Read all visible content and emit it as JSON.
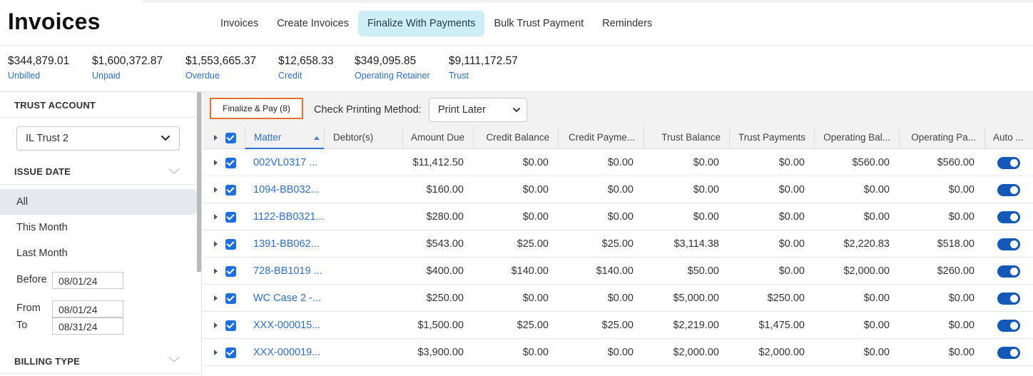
{
  "header": {
    "title": "Invoices",
    "tabs": [
      {
        "label": "Invoices"
      },
      {
        "label": "Create Invoices"
      },
      {
        "label": "Finalize With Payments"
      },
      {
        "label": "Bulk Trust Payment"
      },
      {
        "label": "Reminders"
      }
    ],
    "active_tab": "Finalize With Payments"
  },
  "summary": [
    {
      "amount": "$344,879.01",
      "label": "Unbilled"
    },
    {
      "amount": "$1,600,372.87",
      "label": "Unpaid"
    },
    {
      "amount": "$1,553,665.37",
      "label": "Overdue"
    },
    {
      "amount": "$12,658.33",
      "label": "Credit"
    },
    {
      "amount": "$349,095.85",
      "label": "Operating Retainer"
    },
    {
      "amount": "$9,111,172.57",
      "label": "Trust"
    }
  ],
  "sidebar": {
    "trust_account_heading": "TRUST ACCOUNT",
    "trust_account_value": "IL Trust 2",
    "issue_date_heading": "ISSUE DATE",
    "date_options": [
      {
        "label": "All"
      },
      {
        "label": "This Month"
      },
      {
        "label": "Last Month"
      }
    ],
    "before_label": "Before",
    "before_value": "08/01/24",
    "from_label": "From",
    "from_value": "08/01/24",
    "to_label": "To",
    "to_value": "08/31/24",
    "billing_type_heading": "BILLING TYPE"
  },
  "toolbar": {
    "finalize_label": "Finalize & Pay (8)",
    "check_printing_label": "Check Printing Method:",
    "check_printing_value": "Print Later"
  },
  "table": {
    "columns": [
      "Matter",
      "Debtor(s)",
      "Amount Due",
      "Credit Balance",
      "Credit Payme...",
      "Trust Balance",
      "Trust Payments",
      "Operating Bal...",
      "Operating Pa...",
      "Auto ..."
    ],
    "rows": [
      {
        "matter": "002VL0317 ...",
        "debtor": "",
        "amount_due": "$11,412.50",
        "credit_balance": "$0.00",
        "credit_payment": "$0.00",
        "trust_balance": "$0.00",
        "trust_payments": "$0.00",
        "operating_balance": "$560.00",
        "operating_payment": "$560.00",
        "auto": true
      },
      {
        "matter": "1094-BB032...",
        "debtor": "",
        "amount_due": "$160.00",
        "credit_balance": "$0.00",
        "credit_payment": "$0.00",
        "trust_balance": "$0.00",
        "trust_payments": "$0.00",
        "operating_balance": "$0.00",
        "operating_payment": "$0.00",
        "auto": true
      },
      {
        "matter": "1122-BB0321...",
        "debtor": "",
        "amount_due": "$280.00",
        "credit_balance": "$0.00",
        "credit_payment": "$0.00",
        "trust_balance": "$0.00",
        "trust_payments": "$0.00",
        "operating_balance": "$0.00",
        "operating_payment": "$0.00",
        "auto": true
      },
      {
        "matter": "1391-BB062...",
        "debtor": "",
        "amount_due": "$543.00",
        "credit_balance": "$25.00",
        "credit_payment": "$25.00",
        "trust_balance": "$3,114.38",
        "trust_payments": "$0.00",
        "operating_balance": "$2,220.83",
        "operating_payment": "$518.00",
        "auto": true
      },
      {
        "matter": "728-BB1019 ...",
        "debtor": "",
        "amount_due": "$400.00",
        "credit_balance": "$140.00",
        "credit_payment": "$140.00",
        "trust_balance": "$50.00",
        "trust_payments": "$0.00",
        "operating_balance": "$2,000.00",
        "operating_payment": "$260.00",
        "auto": true
      },
      {
        "matter": "WC Case 2 -...",
        "debtor": "",
        "amount_due": "$250.00",
        "credit_balance": "$0.00",
        "credit_payment": "$0.00",
        "trust_balance": "$5,000.00",
        "trust_payments": "$250.00",
        "operating_balance": "$0.00",
        "operating_payment": "$0.00",
        "auto": true
      },
      {
        "matter": "XXX-000015...",
        "debtor": "",
        "amount_due": "$1,500.00",
        "credit_balance": "$25.00",
        "credit_payment": "$25.00",
        "trust_balance": "$2,219.00",
        "trust_payments": "$1,475.00",
        "operating_balance": "$0.00",
        "operating_payment": "$0.00",
        "auto": true
      },
      {
        "matter": "XXX-000019...",
        "debtor": "",
        "amount_due": "$3,900.00",
        "credit_balance": "$0.00",
        "credit_payment": "$0.00",
        "trust_balance": "$2,000.00",
        "trust_payments": "$2,000.00",
        "operating_balance": "$0.00",
        "operating_payment": "$0.00",
        "auto": true
      }
    ]
  },
  "colors": {
    "accent_link": "#2d6fd0",
    "active_tab_bg": "#cdeef5",
    "highlight_border": "#e8702a",
    "toggle_on": "#1458b8",
    "checkbox": "#1b6fe0"
  }
}
